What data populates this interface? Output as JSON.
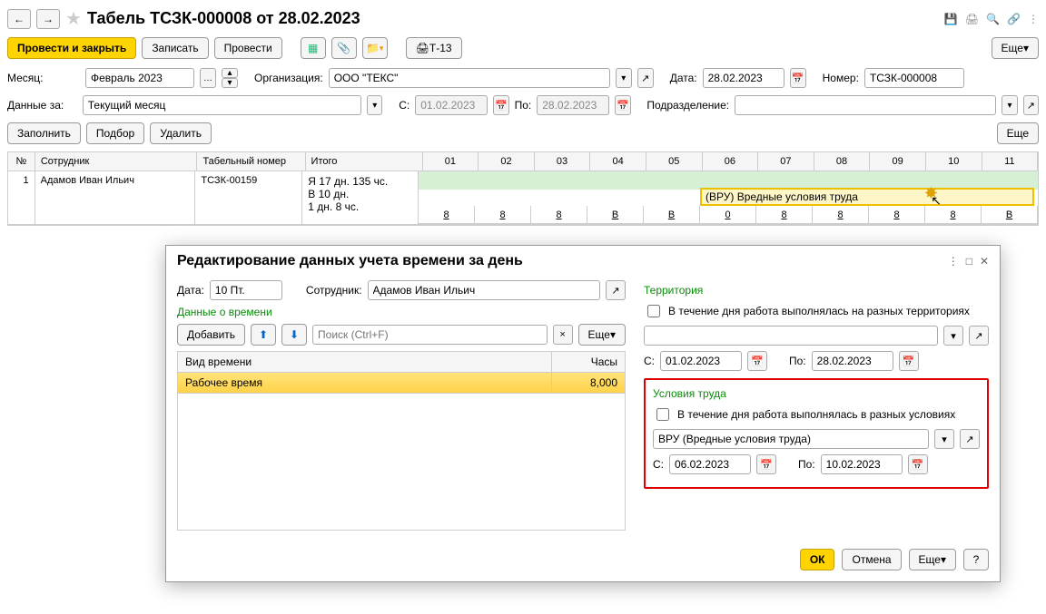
{
  "header": {
    "title": "Табель ТСЗК-000008 от 28.02.2023"
  },
  "toolbar": {
    "post_and_close": "Провести и закрыть",
    "save": "Записать",
    "post": "Провести",
    "t13": "Т-13",
    "more": "Еще"
  },
  "form": {
    "month_label": "Месяц:",
    "month_value": "Февраль 2023",
    "org_label": "Организация:",
    "org_value": "ООО \"ТЕКС\"",
    "date_label": "Дата:",
    "date_value": "28.02.2023",
    "number_label": "Номер:",
    "number_value": "ТСЗК-000008",
    "data_for_label": "Данные за:",
    "data_for_value": "Текущий месяц",
    "from_label": "С:",
    "from_value": "01.02.2023",
    "to_label": "По:",
    "to_value": "28.02.2023",
    "department_label": "Подразделение:",
    "department_value": ""
  },
  "actions": {
    "fill": "Заполнить",
    "pick": "Подбор",
    "delete": "Удалить",
    "more_right": "Еще"
  },
  "table": {
    "headers": {
      "num": "№",
      "employee": "Сотрудник",
      "tabnum": "Табельный номер",
      "total": "Итого"
    },
    "days": [
      "01",
      "02",
      "03",
      "04",
      "05",
      "06",
      "07",
      "08",
      "09",
      "10",
      "11"
    ],
    "row": {
      "num": "1",
      "employee": "Адамов Иван Ильич",
      "tabnum": "ТСЗК-00159",
      "total_lines": [
        "Я 17 дн. 135 чс.",
        "В 10 дн.",
        "1 дн. 8 чс."
      ],
      "vru_label": "(ВРУ) Вредные условия труда",
      "day_values": [
        "8",
        "8",
        "8",
        "В",
        "В",
        "0",
        "8",
        "8",
        "8",
        "8",
        "В"
      ]
    }
  },
  "modal": {
    "title": "Редактирование данных учета времени за день",
    "date_label": "Дата:",
    "date_value": "10 Пт.",
    "employee_label": "Сотрудник:",
    "employee_value": "Адамов Иван Ильич",
    "time_section": "Данные о времени",
    "add_btn": "Добавить",
    "search_placeholder": "Поиск (Ctrl+F)",
    "more": "Еще",
    "tt_h1": "Вид времени",
    "tt_h2": "Часы",
    "tt_row_kind": "Рабочее время",
    "tt_row_hours": "8,000",
    "territory_section": "Территория",
    "territory_check": "В течение дня работа выполнялась на разных территориях",
    "territory_value": "",
    "terr_from_label": "С:",
    "terr_from": "01.02.2023",
    "terr_to_label": "По:",
    "terr_to": "28.02.2023",
    "conditions_section": "Условия труда",
    "conditions_check": "В течение дня работа выполнялась в разных условиях",
    "conditions_value": "ВРУ (Вредные условия труда)",
    "cond_from_label": "С:",
    "cond_from": "06.02.2023",
    "cond_to_label": "По:",
    "cond_to": "10.02.2023",
    "ok": "ОК",
    "cancel": "Отмена",
    "footer_more": "Еще",
    "help": "?"
  }
}
